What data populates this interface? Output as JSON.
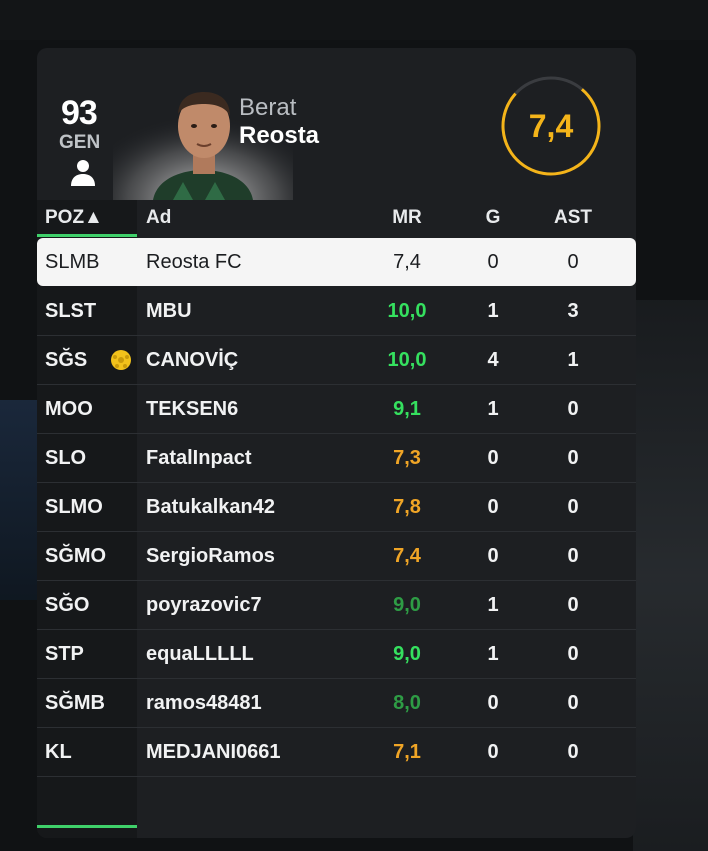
{
  "player": {
    "gen_value": "93",
    "gen_label": "GEN",
    "first_name": "Berat",
    "last_name": "Reosta",
    "rating": "7,4"
  },
  "colors": {
    "accent_green": "#3fd06a",
    "rating_orange": "#f4b41a",
    "mr_bright_green": "#35e05f",
    "mr_dark_green": "#2e9c45",
    "mr_orange": "#f0a526"
  },
  "table": {
    "headers": {
      "poz": "POZ▲",
      "ad": "Ad",
      "mr": "MR",
      "g": "G",
      "ast": "AST"
    },
    "rows": [
      {
        "poz": "SLMB",
        "ad": "Reosta FC",
        "mr": "7,4",
        "mr_color": "#1b1d20",
        "g": "0",
        "ast": "0",
        "selected": true
      },
      {
        "poz": "SLST",
        "ad": "MBU",
        "mr": "10,0",
        "mr_color": "#35e05f",
        "g": "1",
        "ast": "3"
      },
      {
        "poz": "SĞS",
        "ad": "CANOVİÇ",
        "mr": "10,0",
        "mr_color": "#35e05f",
        "g": "4",
        "ast": "1",
        "icon": "star-player-icon"
      },
      {
        "poz": "MOO",
        "ad": "TEKSEN6",
        "mr": "9,1",
        "mr_color": "#35e05f",
        "g": "1",
        "ast": "0"
      },
      {
        "poz": "SLO",
        "ad": "FatalInpact",
        "mr": "7,3",
        "mr_color": "#f0a526",
        "g": "0",
        "ast": "0"
      },
      {
        "poz": "SLMO",
        "ad": "Batukalkan42",
        "mr": "7,8",
        "mr_color": "#f0a526",
        "g": "0",
        "ast": "0"
      },
      {
        "poz": "SĞMO",
        "ad": "SergioRamos",
        "mr": "7,4",
        "mr_color": "#f0a526",
        "g": "0",
        "ast": "0"
      },
      {
        "poz": "SĞO",
        "ad": "poyrazovic7",
        "mr": "9,0",
        "mr_color": "#2e9c45",
        "g": "1",
        "ast": "0"
      },
      {
        "poz": "STP",
        "ad": "equaLLLLL",
        "mr": "9,0",
        "mr_color": "#35e05f",
        "g": "1",
        "ast": "0"
      },
      {
        "poz": "SĞMB",
        "ad": "ramos48481",
        "mr": "8,0",
        "mr_color": "#2e9c45",
        "g": "0",
        "ast": "0"
      },
      {
        "poz": "KL",
        "ad": "MEDJANI0661",
        "mr": "7,1",
        "mr_color": "#f0a526",
        "g": "0",
        "ast": "0"
      }
    ]
  }
}
